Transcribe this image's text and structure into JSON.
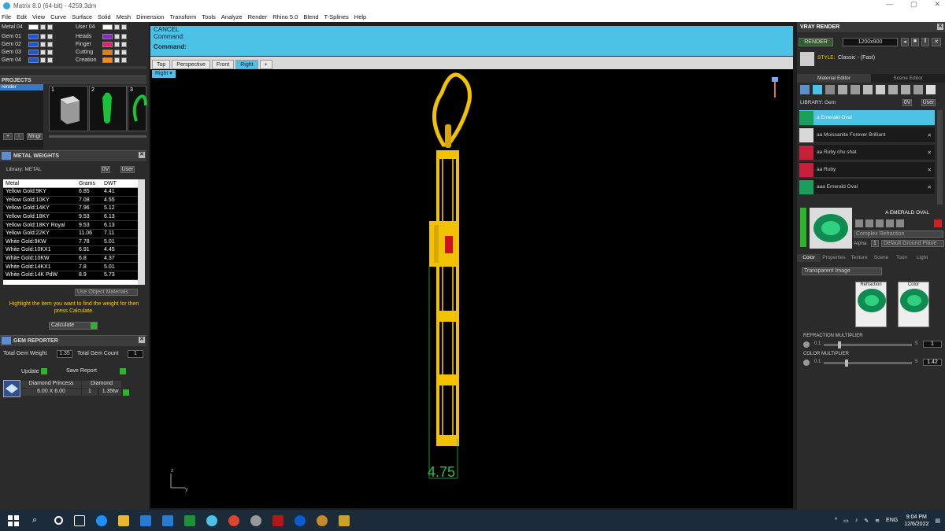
{
  "window": {
    "title": "Matrix 8.0 (64-bit) - 4259.3dm"
  },
  "menu": [
    "File",
    "Edit",
    "View",
    "Curve",
    "Surface",
    "Solid",
    "Mesh",
    "Dimension",
    "Transform",
    "Tools",
    "Analyze",
    "Render",
    "Rhino 5.0",
    "Blend",
    "T-Splines",
    "Help"
  ],
  "layers": {
    "left": [
      "Metal 04",
      "Gem 01",
      "Gem 02",
      "Gem 03",
      "Gem 04"
    ],
    "right": [
      "User 04",
      "Heads",
      "Finger",
      "Cutting",
      "Creation"
    ]
  },
  "projects": {
    "title": "PROJECTS",
    "item": "render",
    "thumbs": [
      "1",
      "2",
      "3"
    ],
    "mngr": "Mngr"
  },
  "metal_weights": {
    "title": "METAL WEIGHTS",
    "library_label": "Library: METAL",
    "toggle_0v": "0V",
    "toggle_user": "User",
    "columns": [
      "Metal",
      "Grams",
      "DWT"
    ],
    "rows": [
      [
        "Yellow Gold:9KY",
        "6.85",
        "4.41"
      ],
      [
        "Yellow Gold:10KY",
        "7.08",
        "4.55"
      ],
      [
        "Yellow Gold:14KY",
        "7.96",
        "5.12"
      ],
      [
        "Yellow Gold:18KY",
        "9.53",
        "6.13"
      ],
      [
        "Yellow Gold:18KY Royal",
        "9.53",
        "6.13"
      ],
      [
        "Yellow Gold:22KY",
        "11.06",
        "7.11"
      ],
      [
        "White Gold:9KW",
        "7.78",
        "5.01"
      ],
      [
        "White Gold:10KX1",
        "6.91",
        "4.45"
      ],
      [
        "White Gold:10KW",
        "6.8",
        "4.37"
      ],
      [
        "White Gold:14KX1",
        "7.8",
        "5.01"
      ],
      [
        "White Gold:14K PdW",
        "8.9",
        "5.73"
      ]
    ],
    "use_object_materials": "Use Object Materials",
    "hint": "Highlight the item you want to find the weight for then press Calculate.",
    "calculate": "Calculate"
  },
  "gem_reporter": {
    "title": "GEM REPORTER",
    "total_weight_label": "Total Gem Weight",
    "total_weight": "1.35",
    "total_count_label": "Total Gem Count",
    "total_count": "1",
    "update": "Update",
    "save_report": "Save Report",
    "gem_name": "Diamond Princess",
    "gem_type": "Diamond",
    "gem_size": "6.00 X 6.00",
    "gem_qty": "1",
    "gem_ctw": "1.35tw"
  },
  "command": {
    "line1": "CANCEL",
    "line2": "Command:",
    "prompt": "Command:"
  },
  "viewport_tabs": [
    "Top",
    "Perspective",
    "Front",
    "Right"
  ],
  "active_view": "Right",
  "view_label": "Right",
  "dimension": "4.75",
  "axes": {
    "z": "z",
    "y": "y"
  },
  "vray": {
    "title": "VRAY RENDER",
    "render_btn": "RENDER",
    "resolution": "1200x900",
    "style_label": "STYLE:",
    "style_value": "Classic - (Fast)",
    "tabs": [
      "Material Editor",
      "Scene Editor"
    ],
    "library_label": "LIBRARY: Gem",
    "toggle_0v": "0V",
    "toggle_user": "User",
    "materials": [
      {
        "name": "a Emerald Oval",
        "color": "#1a9e5c"
      },
      {
        "name": "aa Moissanite Forever Brilliant",
        "color": "#d8d8d8"
      },
      {
        "name": "aa Ruby chu shat",
        "color": "#c8203a"
      },
      {
        "name": "aa Ruby",
        "color": "#c8203a"
      },
      {
        "name": "aaa Emerald Oval",
        "color": "#1a9e5c"
      }
    ],
    "preview_name": "A EMERALD OVAL",
    "shader": "Complex Refraction",
    "alpha_label": "Alpha",
    "ground_plane": "Default Ground Plane",
    "sub_tabs": [
      "Color",
      "Properties",
      "Texture",
      "Scene",
      "Toon",
      "Light"
    ],
    "transparent": "Transparent Image",
    "refraction_label": "Refraction",
    "color_label": "Color",
    "refraction_mult_label": "REFRACTION MULTIPLIER",
    "refraction_min": "0.1",
    "refraction_max": "5",
    "refraction_value": "1",
    "color_mult_label": "COLOR MULTIPLIER",
    "color_min": "0.1",
    "color_max": "5",
    "color_value": "1.42"
  },
  "taskbar": {
    "lang": "ENG",
    "time": "9:04 PM",
    "date": "12/6/2022"
  },
  "colors": {
    "accent": "#4cc2e6",
    "gold": "#f2c200",
    "gem_red": "#d01020",
    "dim_green": "#2fbf4a"
  }
}
